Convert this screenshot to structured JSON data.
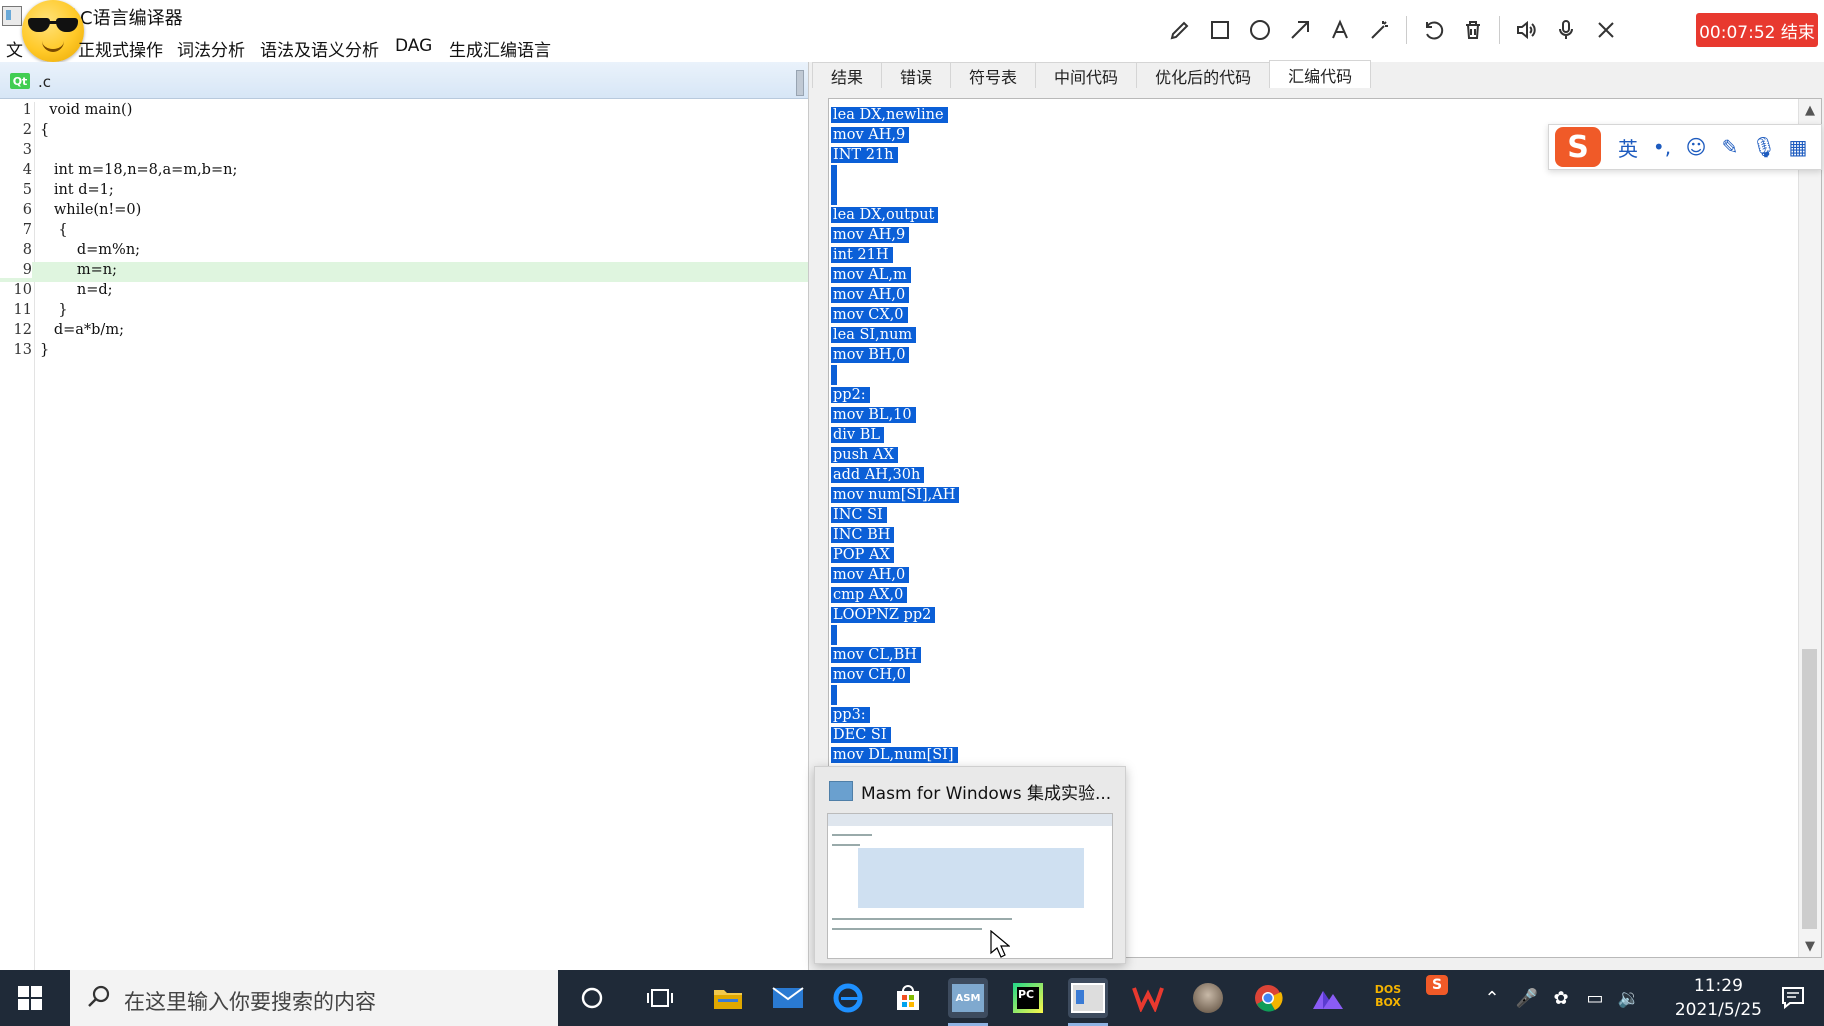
{
  "window": {
    "title": "计C语言编译器"
  },
  "menu": {
    "file": "文",
    "regex": "正规式操作",
    "lexical": "词法分析",
    "syntax": "语法及语义分析",
    "dag": "DAG",
    "asm": "生成汇编语言"
  },
  "recorder": {
    "timer": "00:07:52 结束",
    "tools": [
      "pencil-icon",
      "rectangle-icon",
      "circle-icon",
      "arrow-icon",
      "text-icon",
      "magic-wand-icon",
      "undo-icon",
      "trash-icon",
      "speaker-icon",
      "microphone-icon",
      "close-icon"
    ]
  },
  "editor": {
    "tab_badge": "Qt",
    "tab_name": ".c",
    "highlighted_line": 9,
    "lines": [
      {
        "n": "1",
        "t": "  void main()"
      },
      {
        "n": "2",
        "t": "{"
      },
      {
        "n": "3",
        "t": ""
      },
      {
        "n": "4",
        "t": "   int m=18,n=8,a=m,b=n;"
      },
      {
        "n": "5",
        "t": "   int d=1;"
      },
      {
        "n": "6",
        "t": "   while(n!=0)"
      },
      {
        "n": "7",
        "t": "    {"
      },
      {
        "n": "8",
        "t": "        d=m%n;"
      },
      {
        "n": "9",
        "t": "        m=n;"
      },
      {
        "n": "10",
        "t": "        n=d;"
      },
      {
        "n": "11",
        "t": "    }"
      },
      {
        "n": "12",
        "t": "   d=a*b/m;"
      },
      {
        "n": "13",
        "t": "}"
      }
    ]
  },
  "output": {
    "tabs": [
      "结果",
      "错误",
      "符号表",
      "中间代码",
      "优化后的代码",
      "汇编代码"
    ],
    "active_tab": "汇编代码",
    "asm_lines": [
      "lea DX,newline",
      "mov AH,9",
      "INT 21h",
      "",
      "",
      "lea DX,output",
      "mov AH,9",
      "int 21H",
      "mov AL,m",
      "mov AH,0",
      "mov CX,0",
      "lea SI,num",
      "mov BH,0",
      "",
      "pp2:",
      "mov BL,10",
      "div BL",
      "push AX",
      "add AH,30h",
      "mov num[SI],AH",
      "INC SI",
      "INC BH",
      "POP AX",
      "mov AH,0",
      "cmp AX,0",
      "LOOPNZ pp2",
      "",
      "mov CL,BH",
      "mov CH,0",
      "",
      "pp3:",
      "DEC SI",
      "mov DL,num[SI]"
    ]
  },
  "ime": {
    "logo": "S",
    "mode": "英",
    "punct": "•,"
  },
  "preview": {
    "title": "Masm for Windows 集成实验..."
  },
  "taskbar": {
    "search_placeholder": "在这里输入你要搜索的内容",
    "time": "11:29",
    "date": "2021/5/25",
    "asm_label": "ASM",
    "pc_label": "PC",
    "dosbox_label": "DOS BOX"
  }
}
